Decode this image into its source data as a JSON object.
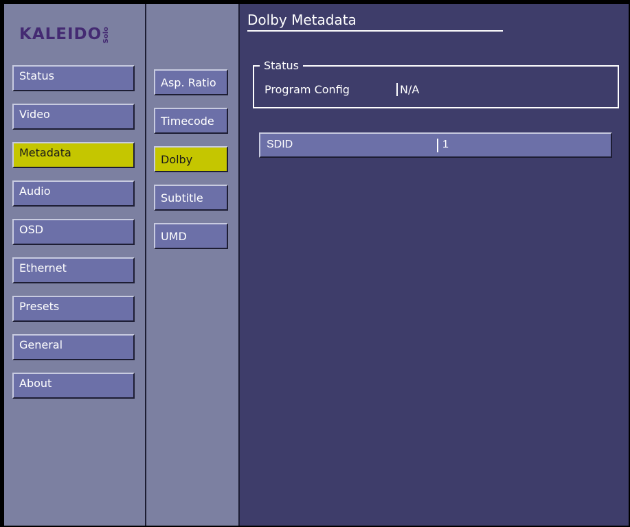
{
  "logo": {
    "brand": "KALEIDO",
    "edition": "Solo"
  },
  "left_nav": [
    {
      "label": "Status"
    },
    {
      "label": "Video"
    },
    {
      "label": "Metadata",
      "active": true
    },
    {
      "label": "Audio"
    },
    {
      "label": "OSD"
    },
    {
      "label": "Ethernet"
    },
    {
      "label": "Presets"
    },
    {
      "label": "General"
    },
    {
      "label": "About"
    }
  ],
  "sub_nav": [
    {
      "label": "Asp. Ratio"
    },
    {
      "label": "Timecode"
    },
    {
      "label": "Dolby",
      "active": true
    },
    {
      "label": "Subtitle"
    },
    {
      "label": "UMD"
    }
  ],
  "main": {
    "title": "Dolby Metadata",
    "status": {
      "legend": "Status",
      "program_config_label": "Program Config",
      "program_config_value": "N/A"
    },
    "sdid": {
      "label": "SDID",
      "value": "1"
    }
  },
  "colors": {
    "panel": "#7c80a1",
    "main_bg": "#3e3d6a",
    "button": "#6c70a8",
    "active": "#c5c600",
    "logo": "#442a72"
  }
}
